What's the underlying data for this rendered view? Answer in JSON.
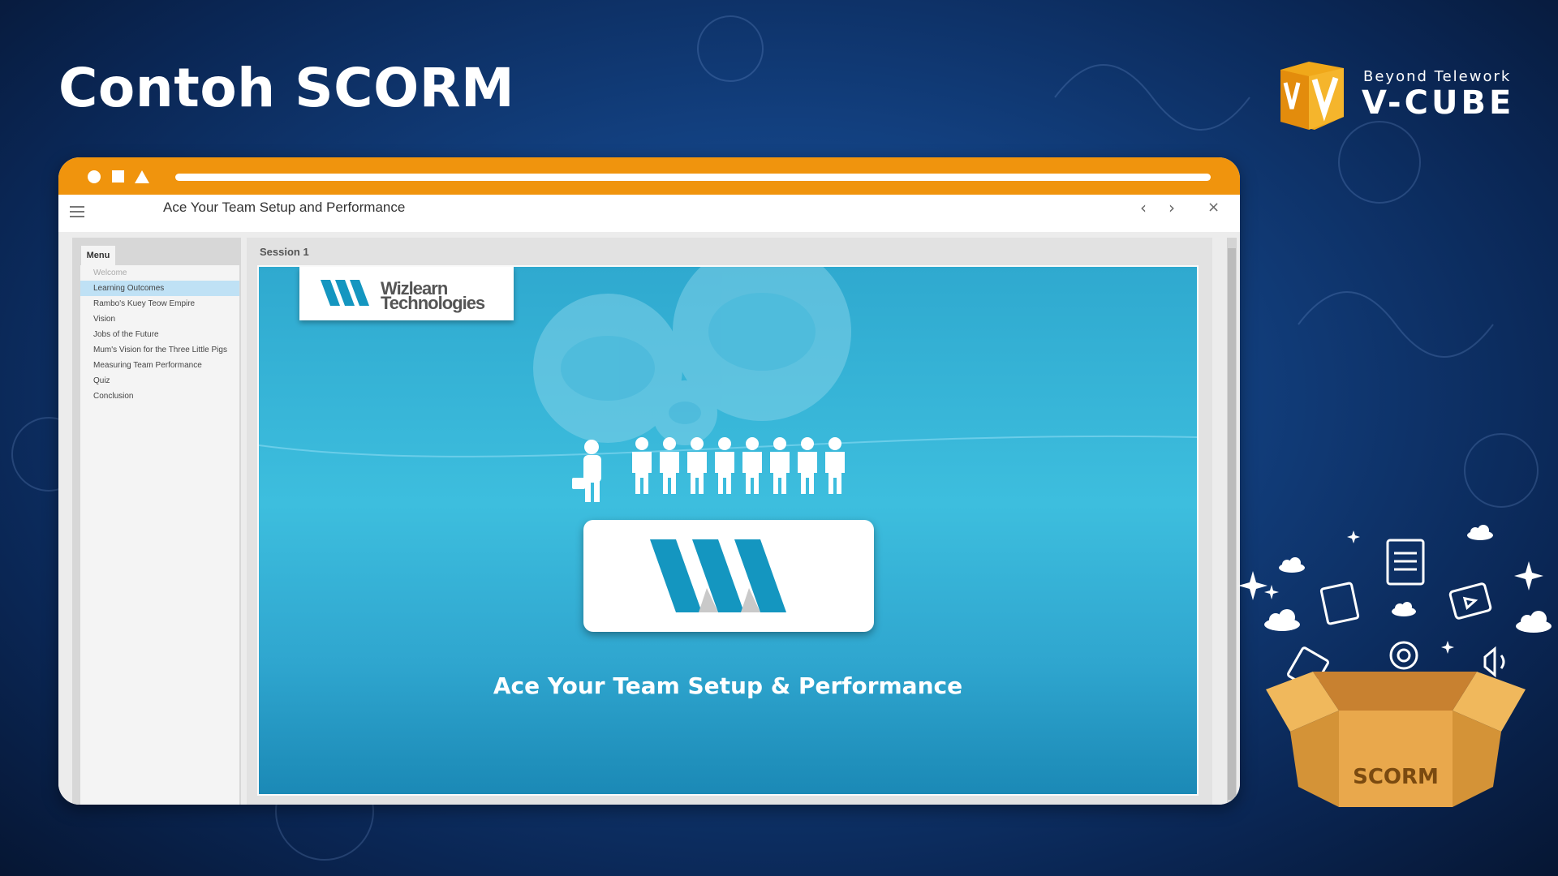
{
  "slide": {
    "title": "Contoh SCORM",
    "brand_tagline": "Beyond Telework",
    "brand_name": "V-CUBE"
  },
  "colors": {
    "window_bar": "#f0940d",
    "stage_blue": "#3dbede",
    "logo_teal": "#1496c0",
    "menu_highlight": "#bfe1f5",
    "box_orange": "#e9a84c"
  },
  "app": {
    "course_title": "Ace Your Team Setup and Performance",
    "menu_tab": "Menu",
    "session_label": "Session 1",
    "prev_icon": "chevron-left-icon",
    "next_icon": "chevron-right-icon",
    "close_icon": "close-icon",
    "menu_items": [
      {
        "label": "Welcome"
      },
      {
        "label": "Learning Outcomes"
      },
      {
        "label": "Rambo's Kuey Teow Empire"
      },
      {
        "label": "Vision"
      },
      {
        "label": "Jobs of the Future"
      },
      {
        "label": "Mum's Vision for the Three Little Pigs"
      },
      {
        "label": "Measuring Team Performance"
      },
      {
        "label": "Quiz"
      },
      {
        "label": "Conclusion"
      }
    ]
  },
  "stage": {
    "logo_line1": "Wizlearn",
    "logo_line2": "Technologies",
    "caption": "Ace Your Team Setup & Performance"
  },
  "decoration": {
    "box_label": "SCORM"
  },
  "symbols": {
    "prev": "‹",
    "next": "›",
    "close": "×"
  }
}
